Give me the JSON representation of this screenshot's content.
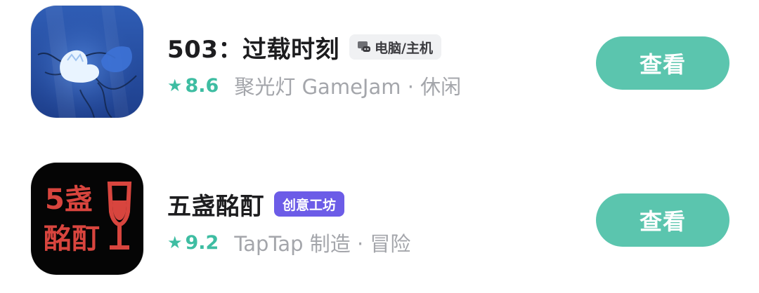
{
  "games": [
    {
      "title": "503：过载时刻",
      "tag_label": "电脑/主机",
      "tag_icon": "monitor-gamepad-icon",
      "rating": "8.6",
      "subtitle": "聚光灯 GameJam · 休闲",
      "button_label": "查看",
      "icon_art": "underwater-diver-icon"
    },
    {
      "title": "五盏酩酊",
      "tag_label": "创意工坊",
      "rating": "9.2",
      "subtitle": "TapTap 制造 · 冒险",
      "button_label": "查看",
      "icon_art": {
        "name": "wine-glass-text-icon",
        "text_line1": "5盏",
        "text_line2": "酩酊"
      }
    }
  ],
  "colors": {
    "accent": "#3ebda2",
    "button": "#5bc5ae",
    "workshop_tag": "#6c5ce7",
    "platform_tag_bg": "#f0f1f3",
    "subtitle": "#a4a6ab",
    "title": "#1d1d1f"
  }
}
